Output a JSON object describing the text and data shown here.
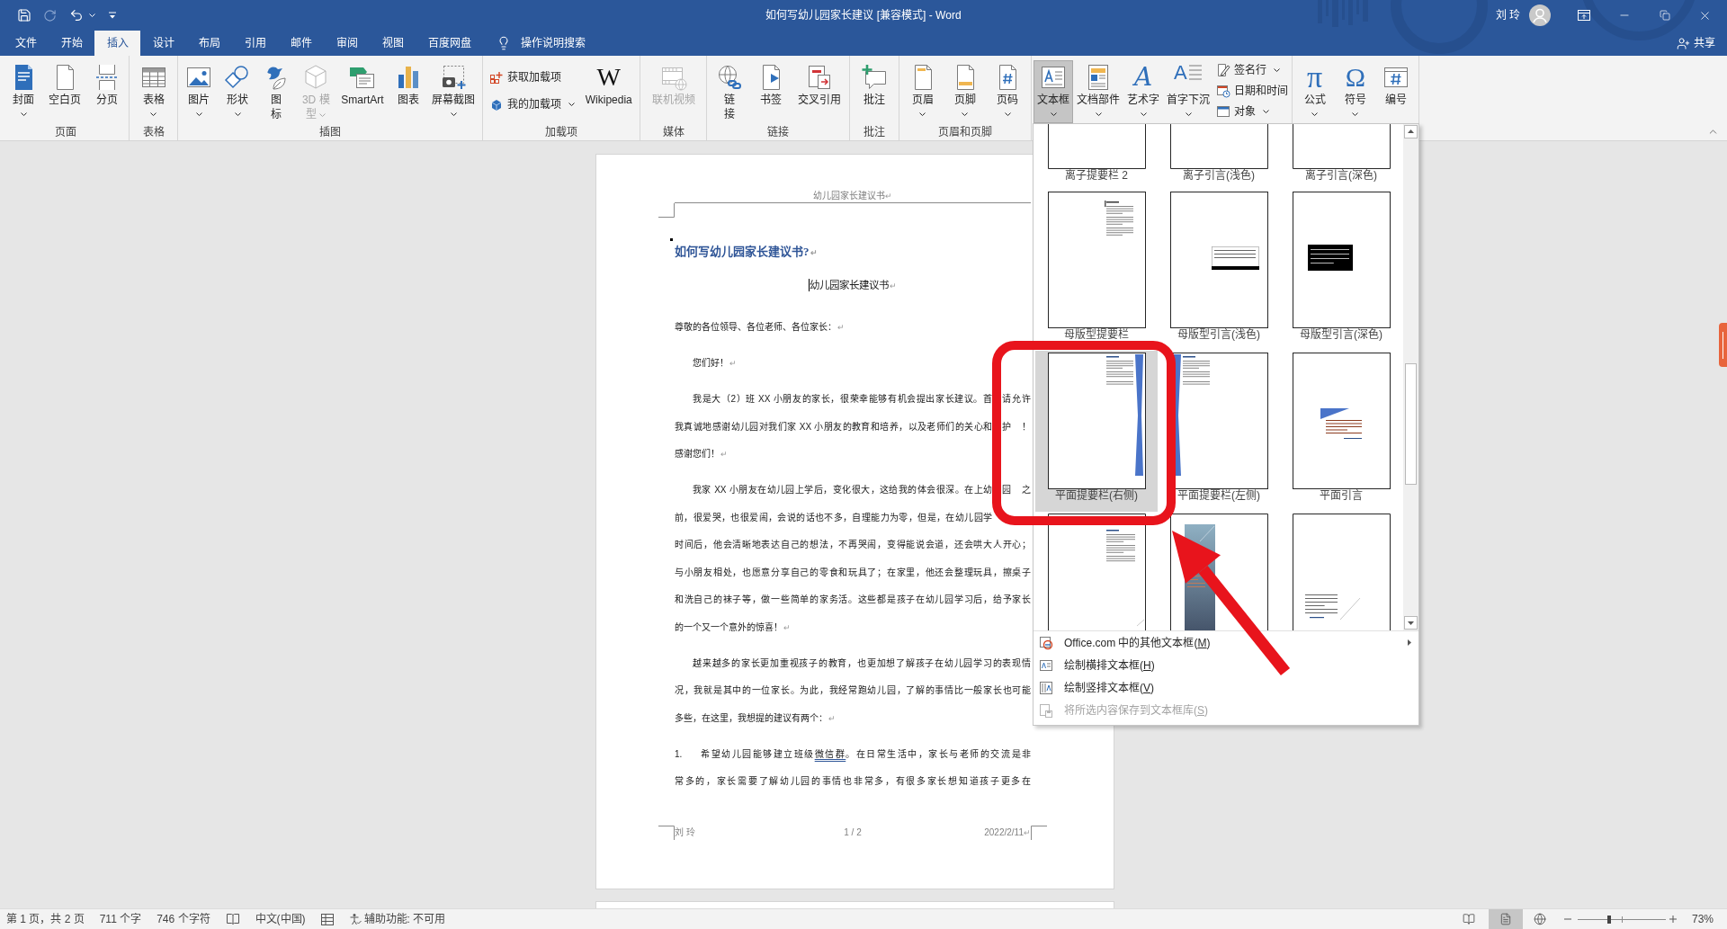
{
  "window": {
    "title": "如何写幼儿园家长建议 [兼容模式] - Word",
    "user": "刘 玲"
  },
  "quick_access": [
    {
      "disabled": false
    },
    {
      "disabled": true
    },
    {
      "disabled": false
    },
    {
      "disabled": false
    }
  ],
  "tabs": [
    {
      "label": "文件",
      "selected": false
    },
    {
      "label": "开始",
      "selected": false
    },
    {
      "label": "插入",
      "selected": true
    },
    {
      "label": "设计",
      "selected": false
    },
    {
      "label": "布局",
      "selected": false
    },
    {
      "label": "引用",
      "selected": false
    },
    {
      "label": "邮件",
      "selected": false
    },
    {
      "label": "审阅",
      "selected": false
    },
    {
      "label": "视图",
      "selected": false
    },
    {
      "label": "百度网盘",
      "selected": false
    }
  ],
  "tell_me": {
    "placeholder": "操作说明搜索"
  },
  "share": {
    "label": "共享"
  },
  "ribbon": {
    "groups": [
      {
        "label": "页面",
        "items": [
          {
            "label": "封面",
            "kind": "large",
            "dropdown": true,
            "disabled": false,
            "pressed": false
          },
          {
            "label": "空白页",
            "kind": "large",
            "dropdown": false,
            "disabled": false,
            "pressed": false
          },
          {
            "label": "分页",
            "kind": "large",
            "dropdown": false,
            "disabled": false,
            "pressed": false
          }
        ]
      },
      {
        "label": "表格",
        "items": [
          {
            "label": "表格",
            "kind": "large",
            "dropdown": true,
            "disabled": false,
            "pressed": false
          }
        ]
      },
      {
        "label": "插图",
        "items": [
          {
            "label": "图片",
            "kind": "large",
            "dropdown": true,
            "disabled": false,
            "pressed": false
          },
          {
            "label": "形状",
            "kind": "large",
            "dropdown": true,
            "disabled": false,
            "pressed": false
          },
          {
            "label": "图标",
            "kind": "narrow",
            "dropdown": false,
            "disabled": false,
            "pressed": false
          },
          {
            "label": "3D 模型",
            "kind": "narrow",
            "dropdown": true,
            "disabled": true,
            "pressed": false
          },
          {
            "label": "SmartArt",
            "kind": "large",
            "dropdown": false,
            "disabled": false,
            "pressed": false
          },
          {
            "label": "图表",
            "kind": "large",
            "dropdown": false,
            "disabled": false,
            "pressed": false
          },
          {
            "label": "屏幕截图",
            "kind": "large",
            "dropdown": true,
            "disabled": false,
            "pressed": false
          }
        ]
      },
      {
        "label": "加载项",
        "items": [
          {
            "label": "获取加载项",
            "kind": "small",
            "dropdown": false,
            "disabled": false,
            "pressed": false
          },
          {
            "label": "我的加载项",
            "kind": "small",
            "dropdown": true,
            "disabled": false,
            "pressed": false
          },
          {
            "label": "Wikipedia",
            "kind": "large",
            "glyph": "W",
            "dropdown": false,
            "disabled": false,
            "pressed": false
          }
        ]
      },
      {
        "label": "媒体",
        "items": [
          {
            "label": "联机视频",
            "kind": "large",
            "dropdown": false,
            "disabled": true,
            "pressed": false
          }
        ]
      },
      {
        "label": "链接",
        "items": [
          {
            "label": "链接",
            "kind": "narrow",
            "dropdown": false,
            "disabled": false,
            "pressed": false
          },
          {
            "label": "书签",
            "kind": "large",
            "dropdown": false,
            "disabled": false,
            "pressed": false
          },
          {
            "label": "交叉引用",
            "kind": "large",
            "dropdown": false,
            "disabled": false,
            "pressed": false
          }
        ]
      },
      {
        "label": "批注",
        "items": [
          {
            "label": "批注",
            "kind": "large",
            "dropdown": false,
            "disabled": false,
            "pressed": false
          }
        ]
      },
      {
        "label": "页眉和页脚",
        "items": [
          {
            "label": "页眉",
            "kind": "large",
            "dropdown": true,
            "disabled": false,
            "pressed": false
          },
          {
            "label": "页脚",
            "kind": "large",
            "dropdown": true,
            "disabled": false,
            "pressed": false
          },
          {
            "label": "页码",
            "kind": "large",
            "dropdown": true,
            "disabled": false,
            "pressed": false
          }
        ]
      },
      {
        "items": [
          {
            "label": "文本框",
            "kind": "large",
            "dropdown": true,
            "disabled": false,
            "pressed": true
          },
          {
            "label": "文档部件",
            "kind": "large",
            "dropdown": true,
            "disabled": false,
            "pressed": false
          },
          {
            "label": "艺术字",
            "kind": "large",
            "glyph": "A",
            "dropdown": true,
            "disabled": false,
            "pressed": false
          },
          {
            "label": "首字下沉",
            "kind": "large",
            "glyph": "A",
            "dropdown": true,
            "disabled": false,
            "pressed": false
          },
          {
            "label": "签名行",
            "kind": "small",
            "dropdown": true,
            "disabled": false,
            "pressed": false
          },
          {
            "label": "日期和时间",
            "kind": "small",
            "dropdown": false,
            "disabled": false,
            "pressed": false
          },
          {
            "label": "对象",
            "kind": "small",
            "dropdown": true,
            "disabled": false,
            "pressed": false
          }
        ]
      },
      {
        "items": [
          {
            "label": "公式",
            "kind": "large",
            "glyph": "π",
            "dropdown": true,
            "disabled": false,
            "pressed": false
          },
          {
            "label": "符号",
            "kind": "large",
            "glyph": "Ω",
            "dropdown": true,
            "disabled": false,
            "pressed": false
          },
          {
            "label": "编号",
            "kind": "large",
            "dropdown": false,
            "disabled": false,
            "pressed": false
          }
        ]
      }
    ]
  },
  "document": {
    "header": {
      "text": "幼儿园家长建议书",
      "end_mark": "↵"
    },
    "paragraphs": [
      {
        "kind": "heading",
        "indent": false,
        "cursor": false,
        "lines": [
          {
            "text": "如何写幼儿园家长建议书?",
            "covered": false
          }
        ],
        "end_mark": "↵"
      },
      {
        "kind": "title",
        "indent": false,
        "cursor": true,
        "lines": [
          {
            "text": "幼儿园家长建议书",
            "covered": false
          }
        ],
        "end_mark": "↵"
      },
      {
        "kind": "body",
        "indent": false,
        "cursor": false,
        "lines": [
          {
            "text": "尊敬的各位领导、各位老师、各位家长：",
            "covered": false
          }
        ],
        "end_mark": "↵"
      },
      {
        "kind": "body",
        "indent": true,
        "cursor": false,
        "lines": [
          {
            "text": "您们好！",
            "covered": false
          }
        ],
        "end_mark": "↵"
      },
      {
        "kind": "body",
        "indent": true,
        "cursor": false,
        "lines": [
          {
            "text": "我是大（2）班 XX 小朋友的家长，很荣幸能够有机会提出家长建议。首",
            "after": "请允许",
            "covered": true
          },
          {
            "text": "我真诚地感谢幼儿园对我们家 XX 小朋友的教育和培养，以及老师们的关心和",
            "after": "护！",
            "covered": true
          },
          {
            "text": "感谢您们！",
            "covered": false
          }
        ],
        "end_mark": "↵"
      },
      {
        "kind": "body",
        "indent": true,
        "cursor": false,
        "lines": [
          {
            "text": "我家 XX 小朋友在幼儿园上学后，变化很大，这给我的体会很深。在上幼",
            "after": "园之",
            "covered": true
          },
          {
            "text": "前，很爱哭，也很爱闹，会说的话也不多，自理能力为零，但是，在幼儿园学",
            "covered": true
          },
          {
            "text": "时间后，他会清晰地表达自己的想法，不再哭闹，变得能说会道，还会哄大人开心；",
            "covered": false
          },
          {
            "text": "与小朋友相处，也愿意分享自己的零食和玩具了；在家里，他还会整理玩具，擦桌子",
            "covered": false
          },
          {
            "text": "和洗自己的袜子等，做一些简单的家务活。这些都是孩子在幼儿园学习后，给予家长",
            "covered": false
          },
          {
            "text": "的一个又一个意外的惊喜！",
            "covered": false
          }
        ],
        "end_mark": "↵"
      },
      {
        "kind": "body",
        "indent": true,
        "cursor": false,
        "lines": [
          {
            "text": "越来越多的家长更加重视孩子的教育，也更加想了解孩子在幼儿园学习的表现情",
            "covered": false
          },
          {
            "text": "况，我就是其中的一位家长。为此，我经常跑幼儿园，了解的事情比一般家长也可能",
            "covered": false
          },
          {
            "text": "多些，在这里，我想提的建议有两个：",
            "covered": false
          }
        ],
        "end_mark": "↵"
      },
      {
        "kind": "list",
        "number": "1.",
        "indent": false,
        "cursor": false,
        "lines": [
          {
            "text": "希望幼儿园能够建立班级",
            "flagged": "微信群",
            "text_end": "。在日常生活中，家长与老师的交流是非",
            "covered": false
          },
          {
            "text": "常多的，家长需要了解幼儿园的事情也非常多，有很多家长想知道孩子更多在",
            "covered": false
          }
        ]
      }
    ],
    "footer": {
      "author": "刘 玲",
      "page": "1 / 2",
      "date": "2022/2/11",
      "end_mark": "↵"
    }
  },
  "textbox_gallery": {
    "items": [
      {
        "label": "离子提要栏 2",
        "kind": "blank",
        "selected": false
      },
      {
        "label": "离子引言(浅色)",
        "kind": "blank",
        "selected": false
      },
      {
        "label": "离子引言(深色)",
        "kind": "blank",
        "selected": false
      },
      {
        "label": "母版型提要栏",
        "kind": "sidebar",
        "selected": false
      },
      {
        "label": "母版型引言(浅色)",
        "kind": "boxlight",
        "selected": false
      },
      {
        "label": "母版型引言(深色)",
        "kind": "boxdark",
        "selected": false
      },
      {
        "label": "平面提要栏(右侧)",
        "kind": "barright",
        "selected": true
      },
      {
        "label": "平面提要栏(左侧)",
        "kind": "barleft",
        "selected": false
      },
      {
        "label": "平面引言",
        "kind": "wedge",
        "selected": false
      },
      {
        "kind": "textblock",
        "selected": false
      },
      {
        "kind": "gradient",
        "selected": false
      },
      {
        "kind": "corner",
        "selected": false
      }
    ],
    "menu": [
      {
        "label": "Office.com 中的其他文本框(M)",
        "disabled": false,
        "submenu": true
      },
      {
        "label": "绘制横排文本框(H)",
        "disabled": false,
        "submenu": false
      },
      {
        "label": "绘制竖排文本框(V)",
        "disabled": false,
        "submenu": false
      },
      {
        "label": "将所选内容保存到文本框库(S)",
        "disabled": true,
        "submenu": false
      }
    ]
  },
  "status_bar": {
    "items": [
      {
        "kind": "text",
        "text": "第 1 页，共 2 页"
      },
      {
        "kind": "text",
        "text": "711 个字"
      },
      {
        "kind": "text",
        "text": "746 个字符"
      },
      {
        "kind": "icon"
      },
      {
        "kind": "text",
        "text": "中文(中国)"
      },
      {
        "kind": "icon"
      },
      {
        "kind": "icontext",
        "text": "辅助功能: 不可用"
      }
    ],
    "views": [
      {
        "selected": false
      },
      {
        "selected": true
      },
      {
        "selected": false
      }
    ],
    "zoom": {
      "level": 0.36,
      "reading": "73%"
    }
  }
}
